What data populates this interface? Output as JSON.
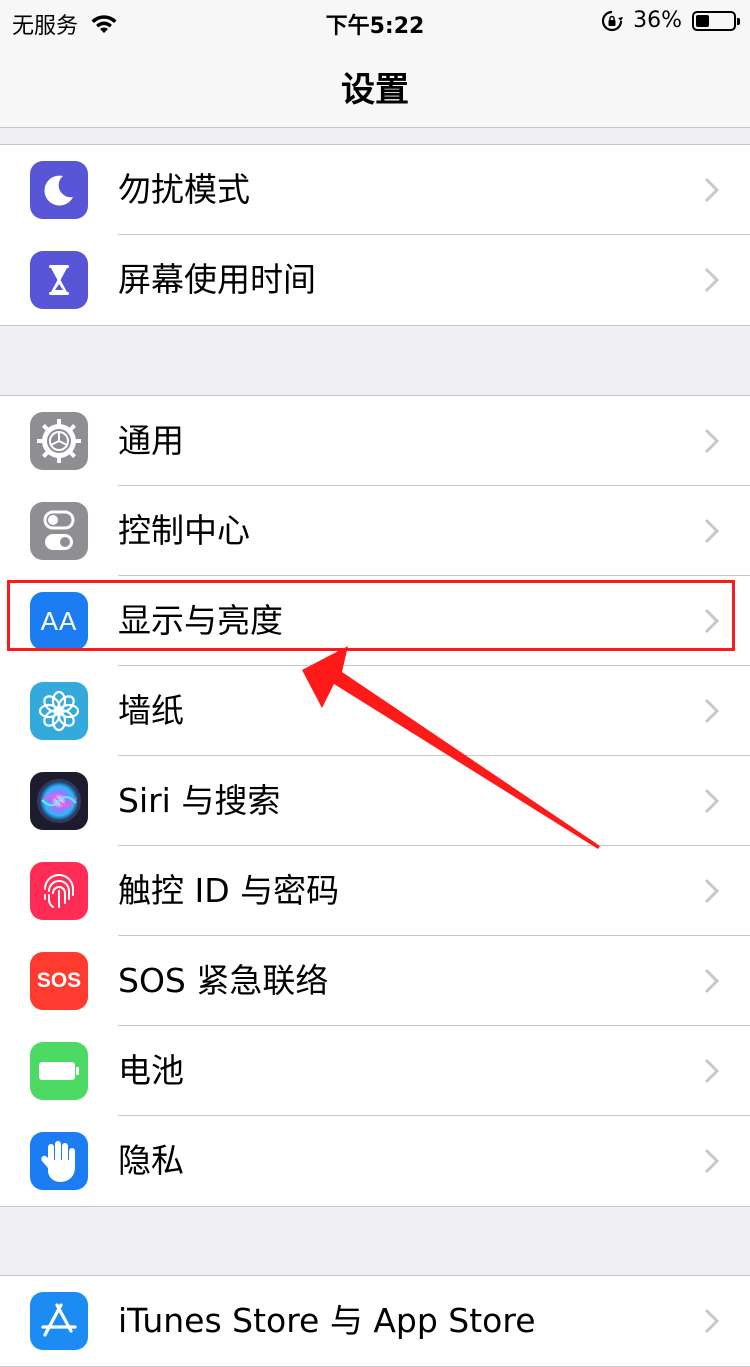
{
  "status_bar": {
    "carrier": "无服务",
    "time": "下午5:22",
    "battery_percent": "36%",
    "battery_level": 0.36,
    "icons": [
      "wifi-icon",
      "orientation-lock-icon",
      "battery-icon"
    ]
  },
  "nav": {
    "title": "设置"
  },
  "groups": [
    {
      "items": [
        {
          "label": "勿扰模式",
          "icon": "moon-icon",
          "color": "#5856d6"
        },
        {
          "label": "屏幕使用时间",
          "icon": "hourglass-icon",
          "color": "#5856d6"
        }
      ]
    },
    {
      "items": [
        {
          "label": "通用",
          "icon": "gear-icon",
          "color": "#8e8e93"
        },
        {
          "label": "控制中心",
          "icon": "toggles-icon",
          "color": "#8e8e93"
        },
        {
          "label": "显示与亮度",
          "icon": "text-size-icon",
          "icon_text": "AA",
          "color": "#1c7cf2"
        },
        {
          "label": "墙纸",
          "icon": "flower-icon",
          "color": "#34aadc"
        },
        {
          "label": "Siri 与搜索",
          "icon": "siri-icon",
          "color": "#1c1c2e"
        },
        {
          "label": "触控 ID 与密码",
          "icon": "fingerprint-icon",
          "color": "#ff2d55"
        },
        {
          "label": "SOS 紧急联络",
          "icon": "sos-icon",
          "icon_text": "SOS",
          "color": "#ff3b30"
        },
        {
          "label": "电池",
          "icon": "battery-icon",
          "color": "#4cd964"
        },
        {
          "label": "隐私",
          "icon": "hand-icon",
          "color": "#1c7cf2"
        }
      ]
    },
    {
      "items": [
        {
          "label": "iTunes Store 与 App Store",
          "icon": "app-store-icon",
          "color": "#1c8cf2"
        }
      ]
    }
  ],
  "annotation": {
    "highlight_color": "#ff1a1a"
  }
}
